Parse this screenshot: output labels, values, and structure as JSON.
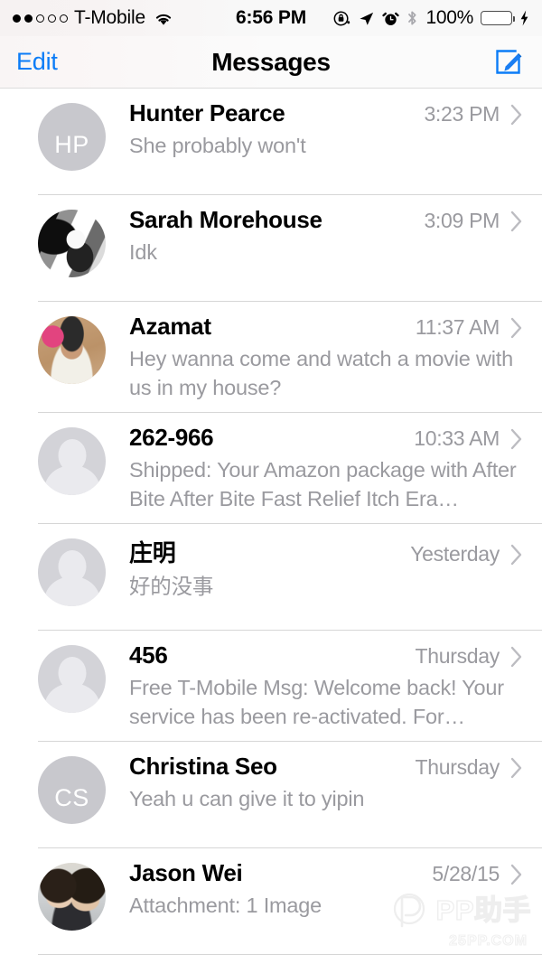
{
  "status_bar": {
    "signal_dots_filled": 2,
    "signal_dots_total": 5,
    "carrier": "T-Mobile",
    "wifi_icon": "wifi-icon",
    "time": "6:56 PM",
    "rotation_lock_icon": "rotation-lock-icon",
    "location_icon": "location-arrow-icon",
    "alarm_icon": "alarm-clock-icon",
    "bluetooth_icon": "bluetooth-icon",
    "battery_percent": "100%",
    "battery_level": 100,
    "charging_icon": "lightning-bolt-icon",
    "battery_color": "#4cd964"
  },
  "nav_bar": {
    "edit_label": "Edit",
    "title": "Messages",
    "compose_icon": "compose-pencil-icon",
    "accent_color": "#0b7cf7"
  },
  "conversations": [
    {
      "name": "Hunter Pearce",
      "preview": "She probably won't",
      "time": "3:23 PM",
      "avatar_type": "initials",
      "initials": "HP",
      "lines": 1
    },
    {
      "name": "Sarah Morehouse",
      "preview": "Idk",
      "time": "3:09 PM",
      "avatar_type": "photo-sarah",
      "initials": "",
      "lines": 1
    },
    {
      "name": "Azamat",
      "preview": "Hey wanna come and watch a movie with us in my house?",
      "time": "11:37 AM",
      "avatar_type": "photo-azamat",
      "initials": "",
      "lines": 2
    },
    {
      "name": "262-966",
      "preview": "Shipped: Your Amazon package with After Bite After Bite Fast Relief Itch Era…",
      "time": "10:33 AM",
      "avatar_type": "silhouette",
      "initials": "",
      "lines": 2
    },
    {
      "name": "庄明",
      "preview": "好的没事",
      "time": "Yesterday",
      "avatar_type": "silhouette",
      "initials": "",
      "lines": 1
    },
    {
      "name": "456",
      "preview": "Free T-Mobile Msg:  Welcome back! Your service has been re-activated. For…",
      "time": "Thursday",
      "avatar_type": "silhouette",
      "initials": "",
      "lines": 2
    },
    {
      "name": "Christina Seo",
      "preview": "Yeah u can give it to yipin",
      "time": "Thursday",
      "avatar_type": "initials",
      "initials": "CS",
      "lines": 1
    },
    {
      "name": "Jason Wei",
      "preview": "Attachment: 1 Image",
      "time": "5/28/15",
      "avatar_type": "photo-jason",
      "initials": "",
      "lines": 1
    }
  ],
  "watermark": {
    "logo_icon": "pp-logo-icon",
    "text": "PP助手",
    "subtext": "25PP.COM"
  }
}
